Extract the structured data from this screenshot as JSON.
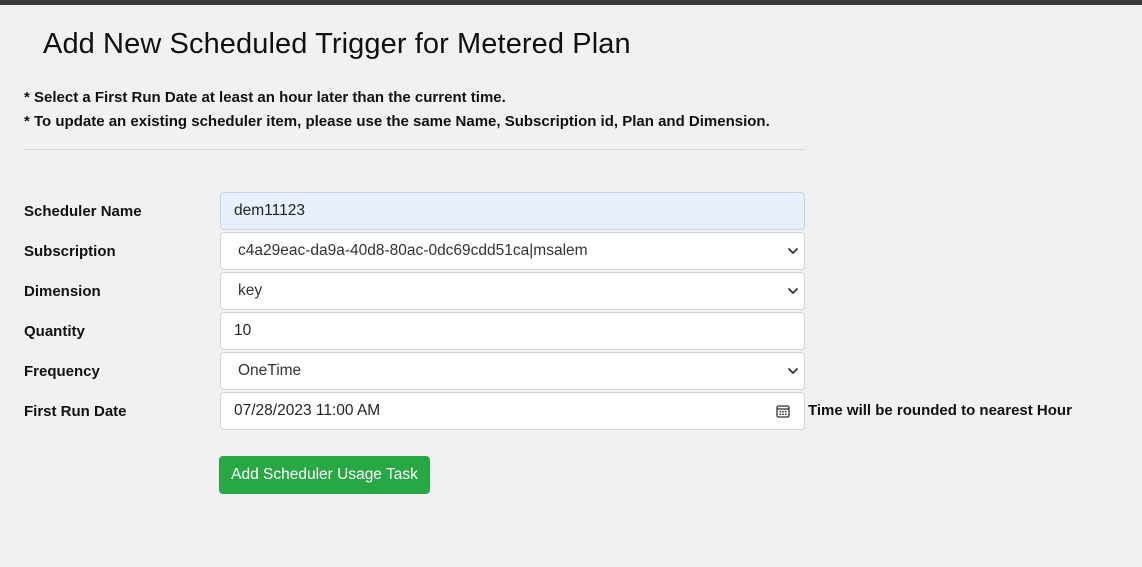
{
  "page": {
    "title": "Add New Scheduled Trigger for Metered Plan",
    "notes": [
      "* Select a First Run Date at least an hour later than the current time.",
      "* To update an existing scheduler item, please use the same Name, Subscription id, Plan and Dimension."
    ]
  },
  "form": {
    "scheduler_name": {
      "label": "Scheduler Name",
      "value": "dem11123"
    },
    "subscription": {
      "label": "Subscription",
      "value": "c4a29eac-da9a-40d8-80ac-0dc69cdd51ca|msalem"
    },
    "dimension": {
      "label": "Dimension",
      "value": "key"
    },
    "quantity": {
      "label": "Quantity",
      "value": "10"
    },
    "frequency": {
      "label": "Frequency",
      "value": "OneTime"
    },
    "first_run_date": {
      "label": "First Run Date",
      "value": "07/28/2023 11:00 AM",
      "hint": "Time will be rounded to nearest Hour"
    },
    "submit_label": "Add Scheduler Usage Task"
  },
  "colors": {
    "submit_bg": "#28a745",
    "autofill_bg": "#e8f0fe",
    "page_bg": "#f1f1f1"
  },
  "icons": {
    "select": "chevron-down-icon",
    "date": "calendar-icon"
  }
}
